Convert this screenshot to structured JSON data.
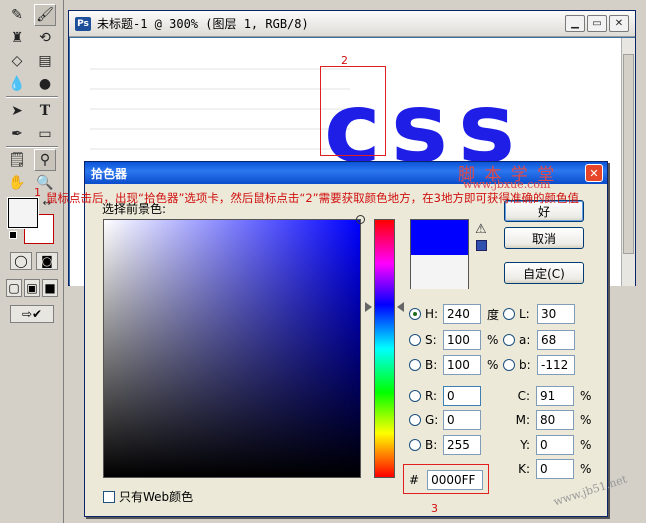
{
  "document": {
    "title": "未标题-1 @ 300% (图层 1, RGB/8)",
    "canvas_text": "css",
    "marker_2": "2"
  },
  "annotation": {
    "marker_1": "1",
    "text": "鼠标点击后，出现“拾色器”选项卡，然后鼠标点击“2”需要获取颜色地方，在3地方即可获得准确的颜色值"
  },
  "watermark": {
    "title": "脚 本 学 堂",
    "url": "www.jbxue.com",
    "corner": "www.jb51.net"
  },
  "picker": {
    "title": "拾色器",
    "label": "选择前景色:",
    "buttons": {
      "ok": "好",
      "cancel": "取消",
      "custom": "自定(C)"
    },
    "hsb": [
      {
        "label": "H:",
        "value": "240",
        "unit": "度",
        "selected": true
      },
      {
        "label": "S:",
        "value": "100",
        "unit": "%",
        "selected": false
      },
      {
        "label": "B:",
        "value": "100",
        "unit": "%",
        "selected": false
      }
    ],
    "rgb": [
      {
        "label": "R:",
        "value": "0"
      },
      {
        "label": "G:",
        "value": "0"
      },
      {
        "label": "B:",
        "value": "255"
      }
    ],
    "lab": [
      {
        "label": "L:",
        "value": "30"
      },
      {
        "label": "a:",
        "value": "68"
      },
      {
        "label": "b:",
        "value": "-112"
      }
    ],
    "cmyk": [
      {
        "label": "C:",
        "value": "91",
        "unit": "%"
      },
      {
        "label": "M:",
        "value": "80",
        "unit": "%"
      },
      {
        "label": "Y:",
        "value": "0",
        "unit": "%"
      },
      {
        "label": "K:",
        "value": "0",
        "unit": "%"
      }
    ],
    "hex": {
      "label": "#",
      "value": "0000FF",
      "marker": "3"
    },
    "web_only": "只有Web颜色",
    "new_color": "#0000ff",
    "current_color": "#f4f4f4"
  }
}
